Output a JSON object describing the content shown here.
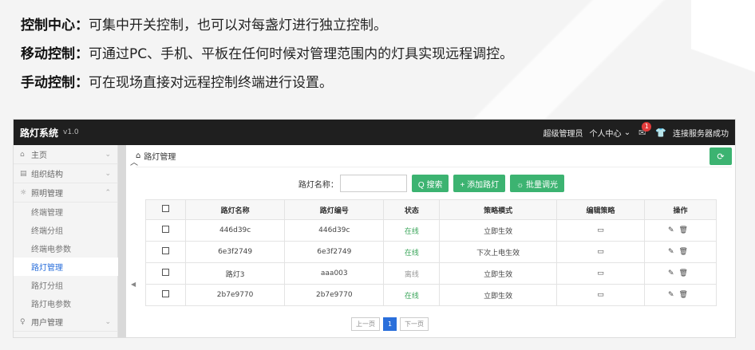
{
  "intro": [
    {
      "key": "控制中心：",
      "text": "可集中开关控制，也可以对每盏灯进行独立控制。"
    },
    {
      "key": "移动控制：",
      "text": "可通过PC、手机、平板在任何时候对管理范围内的灯具实现远程调控。"
    },
    {
      "key": "手动控制：",
      "text": "可在现场直接对远程控制终端进行设置。"
    }
  ],
  "app": {
    "brand": "路灯系统",
    "version": "v1.0",
    "user_role": "超级管理员",
    "personal_center": "个人中心",
    "mail_badge": "1",
    "status": "连接服务器成功"
  },
  "sidebar": {
    "groups": [
      {
        "icon": "⌂",
        "label": "主页"
      },
      {
        "icon": "▤",
        "label": "组织结构"
      },
      {
        "icon": "☼",
        "label": "照明管理"
      }
    ],
    "sub_items": [
      "终端管理",
      "终端分组",
      "终端电参数",
      "路灯管理",
      "路灯分组",
      "路灯电参数"
    ],
    "last_group": {
      "icon": "♀",
      "label": "用户管理"
    }
  },
  "breadcrumb": "路灯管理",
  "filter": {
    "label": "路灯名称：",
    "placeholder": "",
    "search": "Q 搜索",
    "add": "+ 添加路灯",
    "batch": "☼ 批量调光"
  },
  "table": {
    "headers": [
      "路灯名称",
      "路灯编号",
      "状态",
      "策略模式",
      "编辑策略",
      "操作"
    ],
    "rows": [
      {
        "name": "446d39c",
        "code": "446d39c",
        "status": "在线",
        "mode": "立即生效"
      },
      {
        "name": "6e3f2749",
        "code": "6e3f2749",
        "status": "在线",
        "mode": "下次上电生效"
      },
      {
        "name": "路灯3",
        "code": "aaa003",
        "status": "离线",
        "mode": "立即生效"
      },
      {
        "name": "2b7e9770",
        "code": "2b7e9770",
        "status": "在线",
        "mode": "立即生效"
      }
    ]
  },
  "pager": {
    "prev": "上一页",
    "current": "1",
    "next": "下一页"
  },
  "colors": {
    "accent_green": "#3cb371",
    "active_blue": "#2a6fdb",
    "topbar": "#1f1f1f"
  }
}
